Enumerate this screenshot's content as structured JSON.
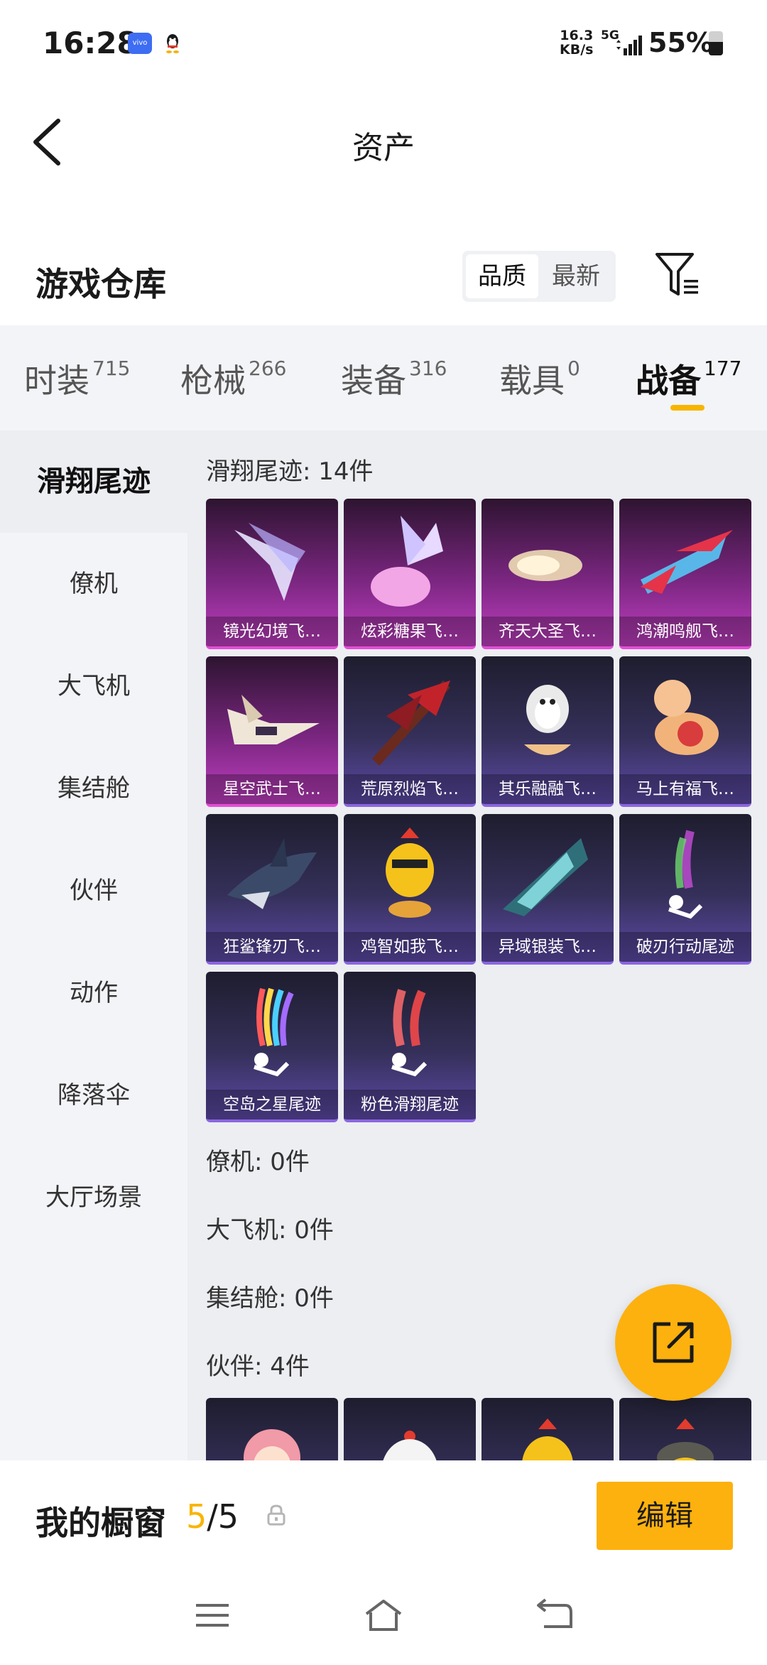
{
  "status_bar": {
    "time": "16:28",
    "speed_value": "16.3",
    "speed_unit": "KB/s",
    "network": "5G",
    "battery_text": "55%",
    "battery_level": 0.55,
    "icons": [
      "vivo-icon",
      "qq-icon",
      "signal-icon",
      "battery-icon"
    ]
  },
  "nav": {
    "title": "资产",
    "back_icon": "back-arrow-icon"
  },
  "section": {
    "title": "游戏仓库",
    "sort": [
      "品质",
      "最新"
    ],
    "sort_active": "品质",
    "filter_icon": "filter-icon"
  },
  "tabs": [
    {
      "label": "时装",
      "count": "715"
    },
    {
      "label": "枪械",
      "count": "266"
    },
    {
      "label": "装备",
      "count": "316"
    },
    {
      "label": "载具",
      "count": "0"
    },
    {
      "label": "战备",
      "count": "177",
      "active": true
    }
  ],
  "sidebar": [
    {
      "label": "滑翔尾迹",
      "active": true
    },
    {
      "label": "僚机"
    },
    {
      "label": "大飞机"
    },
    {
      "label": "集结舱"
    },
    {
      "label": "伙伴"
    },
    {
      "label": "动作"
    },
    {
      "label": "降落伞"
    },
    {
      "label": "大厅场景"
    }
  ],
  "groups": {
    "glide_trail_title": "滑翔尾迹: 14件",
    "wingman_title": "僚机: 0件",
    "big_plane_title": "大飞机: 0件",
    "pod_title": "集结舱: 0件",
    "partner_title": "伙伴: 4件"
  },
  "items": [
    {
      "name": "镜光幻境飞…",
      "rarity": "purple"
    },
    {
      "name": "炫彩糖果飞…",
      "rarity": "purple"
    },
    {
      "name": "齐天大圣飞…",
      "rarity": "purple"
    },
    {
      "name": "鸿潮鸣舰飞…",
      "rarity": "purple"
    },
    {
      "name": "星空武士飞…",
      "rarity": "purple"
    },
    {
      "name": "荒原烈焰飞…",
      "rarity": "blue"
    },
    {
      "name": "其乐融融飞…",
      "rarity": "blue"
    },
    {
      "name": "马上有福飞…",
      "rarity": "blue"
    },
    {
      "name": "狂鲨锋刃飞…",
      "rarity": "blue"
    },
    {
      "name": "鸡智如我飞…",
      "rarity": "blue"
    },
    {
      "name": "异域银装飞…",
      "rarity": "blue"
    },
    {
      "name": "破刃行动尾迹",
      "rarity": "blue"
    },
    {
      "name": "空岛之星尾迹",
      "rarity": "blue"
    },
    {
      "name": "粉色滑翔尾迹",
      "rarity": "blue"
    }
  ],
  "bottom": {
    "title": "我的橱窗",
    "count_current": "5",
    "count_sep_total": "/5",
    "edit_label": "编辑"
  },
  "colors": {
    "accent": "#fdb10e",
    "highlight": "#f7b500",
    "purple_rarity": "#c13fc2",
    "blue_rarity": "#5e4aa8"
  }
}
